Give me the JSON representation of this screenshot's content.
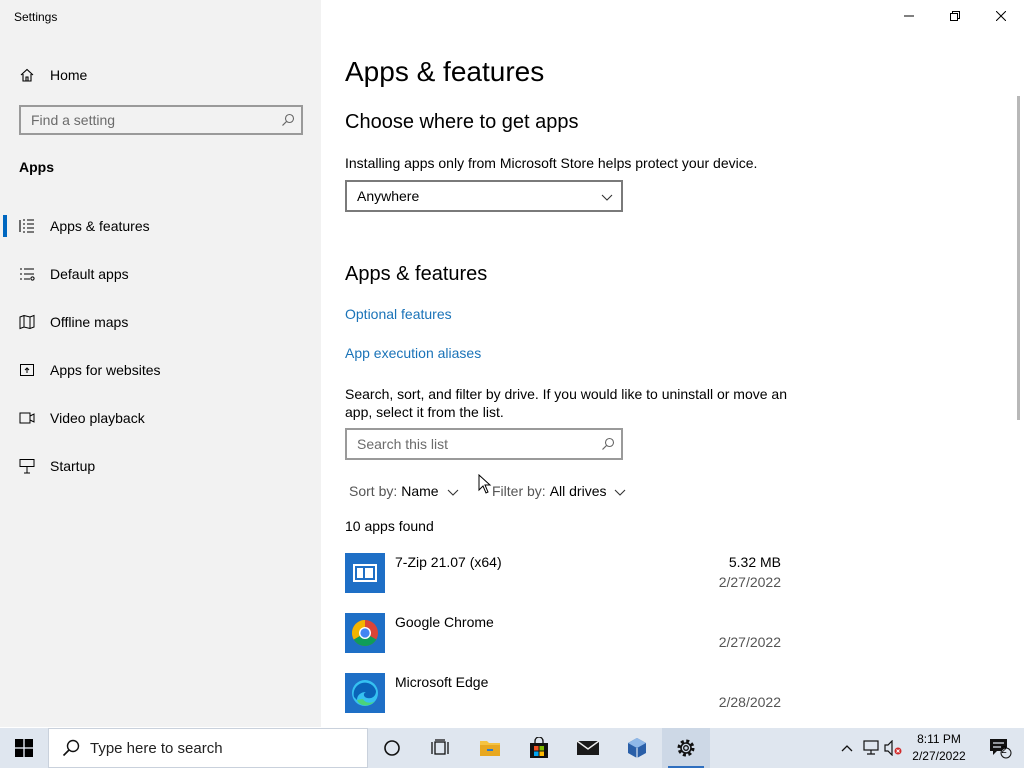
{
  "window": {
    "title": "Settings"
  },
  "sidebar": {
    "home_label": "Home",
    "search_placeholder": "Find a setting",
    "section_label": "Apps",
    "items": [
      {
        "label": "Apps & features",
        "icon": "list-icon",
        "active": true
      },
      {
        "label": "Default apps",
        "icon": "default-apps-icon",
        "active": false
      },
      {
        "label": "Offline maps",
        "icon": "map-icon",
        "active": false
      },
      {
        "label": "Apps for websites",
        "icon": "open-in-app-icon",
        "active": false
      },
      {
        "label": "Video playback",
        "icon": "video-icon",
        "active": false
      },
      {
        "label": "Startup",
        "icon": "startup-icon",
        "active": false
      }
    ]
  },
  "main": {
    "page_title": "Apps & features",
    "choose_heading": "Choose where to get apps",
    "choose_description": "Installing apps only from Microsoft Store helps protect your device.",
    "source_dropdown_value": "Anywhere",
    "apps_heading": "Apps & features",
    "optional_features_link": "Optional features",
    "app_aliases_link": "App execution aliases",
    "search_description": "Search, sort, and filter by drive. If you would like to uninstall or move an app, select it from the list.",
    "list_search_placeholder": "Search this list",
    "sort_label": "Sort by:",
    "sort_value": "Name",
    "filter_label": "Filter by:",
    "filter_value": "All drives",
    "apps_found": "10 apps found",
    "apps": [
      {
        "name": "7-Zip 21.07 (x64)",
        "size": "5.32 MB",
        "date": "2/27/2022",
        "icon": "7zip-icon"
      },
      {
        "name": "Google Chrome",
        "size": "",
        "date": "2/27/2022",
        "icon": "chrome-icon"
      },
      {
        "name": "Microsoft Edge",
        "size": "",
        "date": "2/28/2022",
        "icon": "edge-icon"
      }
    ]
  },
  "taskbar": {
    "search_placeholder": "Type here to search",
    "time": "8:11 PM",
    "date": "2/27/2022",
    "notification_count": "2"
  },
  "colors": {
    "accent": "#0067c0",
    "link": "#1a73b8",
    "sidebar_bg": "#f2f2f2",
    "taskbar_bg": "#dfe6ef"
  }
}
